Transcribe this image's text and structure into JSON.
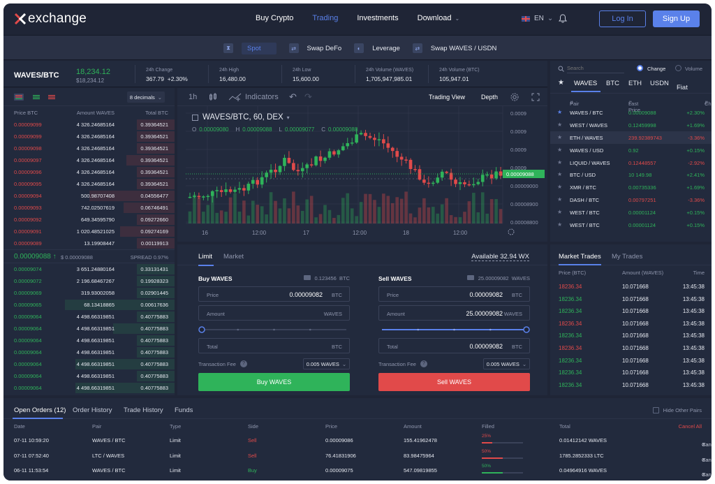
{
  "brand": {
    "name": "exchange"
  },
  "nav": {
    "links": [
      {
        "label": "Buy Crypto",
        "active": false
      },
      {
        "label": "Trading",
        "active": true
      },
      {
        "label": "Investments",
        "active": false
      },
      {
        "label": "Download",
        "active": false
      }
    ],
    "language": "EN",
    "login_label": "Log In",
    "signup_label": "Sign Up"
  },
  "modes": [
    {
      "label": "Spot",
      "active": true
    },
    {
      "label": "Swap DeFo",
      "active": false
    },
    {
      "label": "Leverage",
      "active": false
    },
    {
      "label": "Swap WAVES / USDN",
      "active": false
    }
  ],
  "ticker": {
    "pair": "WAVES/BTC",
    "price": "18,234.12",
    "price_sub": "$18,234.12",
    "stats": [
      {
        "label": "24h Change",
        "value": "367.79",
        "value2": "+2.30%"
      },
      {
        "label": "24h High",
        "value": "16,480.00"
      },
      {
        "label": "24h Low",
        "value": "15,600.00"
      },
      {
        "label": "24h Volume (WAVES)",
        "value": "1,705,947,985.01"
      },
      {
        "label": "24h Volume (BTC)",
        "value": "105,947.01"
      }
    ]
  },
  "orderbook": {
    "decimals_label": "8 decimals",
    "headers": {
      "price": "Price BTC",
      "amount": "Amount WAVES",
      "total": "Total BTC"
    },
    "asks": [
      {
        "price": "0.00009099",
        "amount": "4 326.24685164",
        "total": "0.39364521",
        "depth": 0.22
      },
      {
        "price": "0.00009099",
        "amount": "4 326.24685164",
        "total": "0.39364521",
        "depth": 0.22
      },
      {
        "price": "0.00009098",
        "amount": "4 326.24685164",
        "total": "0.39364521",
        "depth": 0.22
      },
      {
        "price": "0.00009097",
        "amount": "4 326.24685164",
        "total": "0.39364521",
        "depth": 0.28
      },
      {
        "price": "0.00009096",
        "amount": "4 326.24685164",
        "total": "0.39364521",
        "depth": 0.22
      },
      {
        "price": "0.00009095",
        "amount": "4 326.24685164",
        "total": "0.39364521",
        "depth": 0.22
      },
      {
        "price": "0.00009094",
        "amount": "500.98707408",
        "total": "0.04556477",
        "depth": 0.5
      },
      {
        "price": "0.00009093",
        "amount": "742.02507619",
        "total": "0.06746491",
        "depth": 0.3
      },
      {
        "price": "0.00009092",
        "amount": "649.34595790",
        "total": "0.09272660",
        "depth": 0.22
      },
      {
        "price": "0.00009091",
        "amount": "1 020.48521025",
        "total": "0.09274169",
        "depth": 0.32
      },
      {
        "price": "0.00009089",
        "amount": "13.19908447",
        "total": "0.00119913",
        "depth": 0.22
      }
    ],
    "mid": {
      "price": "0.00009088",
      "usd": "$ 0.00009088",
      "spread": "SPREAD 0.97%"
    },
    "bids": [
      {
        "price": "0.00009074",
        "amount": "3 651.24880164",
        "total": "0.33131431",
        "depth": 0.22
      },
      {
        "price": "0.00009072",
        "amount": "2 196.68467267",
        "total": "0.19928323",
        "depth": 0.22
      },
      {
        "price": "0.00009069",
        "amount": "319.93002058",
        "total": "0.02901445",
        "depth": 0.22
      },
      {
        "price": "0.00009065",
        "amount": "68.13418865",
        "total": "0.00617636",
        "depth": 0.64
      },
      {
        "price": "0.00009064",
        "amount": "4 498.66319851",
        "total": "0.40775883",
        "depth": 0.22
      },
      {
        "price": "0.00009064",
        "amount": "4 498.66319851",
        "total": "0.40775883",
        "depth": 0.36
      },
      {
        "price": "0.00009064",
        "amount": "4 498.66319851",
        "total": "0.40775883",
        "depth": 0.22
      },
      {
        "price": "0.00009064",
        "amount": "4 498.66319851",
        "total": "0.40775883",
        "depth": 0.22
      },
      {
        "price": "0.00009064",
        "amount": "4 498.66319851",
        "total": "0.40775883",
        "depth": 0.58
      },
      {
        "price": "0.00009064",
        "amount": "4 498.66319851",
        "total": "0.40775883",
        "depth": 0.22
      },
      {
        "price": "0.00009064",
        "amount": "4 498.66319851",
        "total": "0.40775883",
        "depth": 0.58
      }
    ]
  },
  "chart": {
    "interval_label": "1h",
    "indicators_label": "Indicators",
    "view_trading": "Trading View",
    "view_depth": "Depth",
    "legend_title": "WAVES/BTC, 60, DEX",
    "ohlc": [
      {
        "k": "O",
        "v": "0.00009080"
      },
      {
        "k": "H",
        "v": "0.00009088"
      },
      {
        "k": "L",
        "v": "0.00009077"
      },
      {
        "k": "C",
        "v": "0.00009088"
      }
    ],
    "price_tag": "0.00009088",
    "y_ticks": [
      "0.0009",
      "0.0009",
      "0.0009",
      "0.0009",
      "0.00009000",
      "0.00008900",
      "0.00008800"
    ],
    "x_ticks": [
      "16",
      "12:00",
      "17",
      "12:00",
      "18",
      "12:00"
    ],
    "up_color": "#2fb35a",
    "down_color": "#e14a4a"
  },
  "trade": {
    "tabs": [
      {
        "label": "Limit",
        "active": true
      },
      {
        "label": "Market",
        "active": false
      }
    ],
    "available": "Available 32.94 WX",
    "buy": {
      "title": "Buy WAVES",
      "balance": "0.123456",
      "balance_unit": "BTC",
      "price_label": "Price",
      "price_value": "0.00009082",
      "price_unit": "BTC",
      "amount_label": "Amount",
      "amount_value": "",
      "amount_unit": "WAVES",
      "slider": 0,
      "total_label": "Total",
      "total_value": "",
      "total_unit": "BTC",
      "fee_label": "Transaction Fee",
      "fee_value": "0.005 WAVES",
      "button": "Buy WAVES"
    },
    "sell": {
      "title": "Sell WAVES",
      "balance": "25.00009082",
      "balance_unit": "WAVES",
      "price_label": "Price",
      "price_value": "0.00009082",
      "price_unit": "BTC",
      "amount_label": "Amount",
      "amount_value": "25.00009082",
      "amount_unit": "WAVES",
      "slider": 1,
      "total_label": "Total",
      "total_value": "0.00009082",
      "total_unit": "BTC",
      "fee_label": "Transaction Fee",
      "fee_value": "0.005 WAVES",
      "button": "Sell WAVES"
    }
  },
  "pairs": {
    "search_placeholder": "Search",
    "radio_change": "Change",
    "radio_volume": "Volume",
    "tabs": [
      "WAVES",
      "BTC",
      "ETH",
      "USDN",
      "Fiat"
    ],
    "headers": {
      "pair": "Pair",
      "last": "Last Price",
      "change": "Change"
    },
    "rows": [
      {
        "name": "WAVES / BTC",
        "last": "0.00009088",
        "change": "+2.30%",
        "dir": "up",
        "fav": true
      },
      {
        "name": "WEST / WAVES",
        "last": "0.12459998",
        "change": "+1.69%",
        "dir": "up",
        "fav": false
      },
      {
        "name": "ETH / WAVES",
        "last": "239.92389743",
        "change": "-3.36%",
        "dir": "down",
        "fav": false
      },
      {
        "name": "WAVES / USD",
        "last": "0.92",
        "change": "+0.15%",
        "dir": "up",
        "fav": false
      },
      {
        "name": "LIQUID / WAVES",
        "last": "0.12448557",
        "change": "-2.92%",
        "dir": "down",
        "fav": false
      },
      {
        "name": "BTC / USD",
        "last": "10 149.98",
        "change": "+2.41%",
        "dir": "up",
        "fav": false
      },
      {
        "name": "XMR / BTC",
        "last": "0.00735336",
        "change": "+1.69%",
        "dir": "up",
        "fav": false
      },
      {
        "name": "DASH / BTC",
        "last": "0.00797251",
        "change": "-3.36%",
        "dir": "down",
        "fav": false
      },
      {
        "name": "WEST / BTC",
        "last": "0.00001124",
        "change": "+0.15%",
        "dir": "up",
        "fav": false
      },
      {
        "name": "WEST / BTC",
        "last": "0.00001124",
        "change": "+0.15%",
        "dir": "up",
        "fav": false
      }
    ]
  },
  "market_trades": {
    "tabs": [
      {
        "label": "Market Trades",
        "active": true
      },
      {
        "label": "My Trades",
        "active": false
      }
    ],
    "headers": {
      "price": "Price (BTC)",
      "amount": "Amount (WAVES)",
      "time": "Time"
    },
    "rows": [
      {
        "price": "18236.34",
        "amount": "10.071668",
        "time": "13:45:38",
        "dir": "down"
      },
      {
        "price": "18236.34",
        "amount": "10.071668",
        "time": "13:45:38",
        "dir": "up"
      },
      {
        "price": "18236.34",
        "amount": "10.071668",
        "time": "13:45:38",
        "dir": "up"
      },
      {
        "price": "18236.34",
        "amount": "10.071668",
        "time": "13:45:38",
        "dir": "down"
      },
      {
        "price": "18236.34",
        "amount": "10.071668",
        "time": "13:45:38",
        "dir": "up"
      },
      {
        "price": "18236.34",
        "amount": "10.071668",
        "time": "13:45:38",
        "dir": "down"
      },
      {
        "price": "18236.34",
        "amount": "10.071668",
        "time": "13:45:38",
        "dir": "up"
      },
      {
        "price": "18236.34",
        "amount": "10.071668",
        "time": "13:45:38",
        "dir": "up"
      },
      {
        "price": "18236.34",
        "amount": "10.071668",
        "time": "13:45:38",
        "dir": "up"
      }
    ]
  },
  "orders": {
    "tabs": [
      {
        "label": "Open Orders (12)",
        "active": true
      },
      {
        "label": "Order History",
        "active": false
      },
      {
        "label": "Trade History",
        "active": false
      },
      {
        "label": "Funds",
        "active": false
      }
    ],
    "hide_other_label": "Hide Other Pairs",
    "headers": {
      "date": "Date",
      "pair": "Pair",
      "type": "Type",
      "side": "Side",
      "price": "Price",
      "amount": "Amount",
      "filled": "Filled",
      "total": "Total",
      "cancel_all": "Cancel All"
    },
    "rows": [
      {
        "date": "07-11 10:59:20",
        "pair": "WAVES / BTC",
        "type": "Limit",
        "side": "Sell",
        "price": "0.00009086",
        "amount": "155.41962478",
        "filled": "25%",
        "filled_frac": 0.25,
        "total": "0.01412142 WAVES",
        "cancel": "Cancel"
      },
      {
        "date": "07-11 07:52:40",
        "pair": "LTC / WAVES",
        "type": "Limit",
        "side": "Sell",
        "price": "76.41831906",
        "amount": "83.98475964",
        "filled": "50%",
        "filled_frac": 0.5,
        "total": "1785.2852333 LTC",
        "cancel": "Cancel"
      },
      {
        "date": "06-11 11:53:54",
        "pair": "WAVES / BTC",
        "type": "Limit",
        "side": "Buy",
        "price": "0.00009075",
        "amount": "547.09819855",
        "filled": "50%",
        "filled_frac": 0.5,
        "total": "0.04964916 WAVES",
        "cancel": "Cancel"
      }
    ]
  },
  "colors": {
    "accent": "#5a81ea",
    "up": "#2fb35a",
    "down": "#e14a4a",
    "panel": "#222a3d",
    "background": "#1f2536"
  }
}
